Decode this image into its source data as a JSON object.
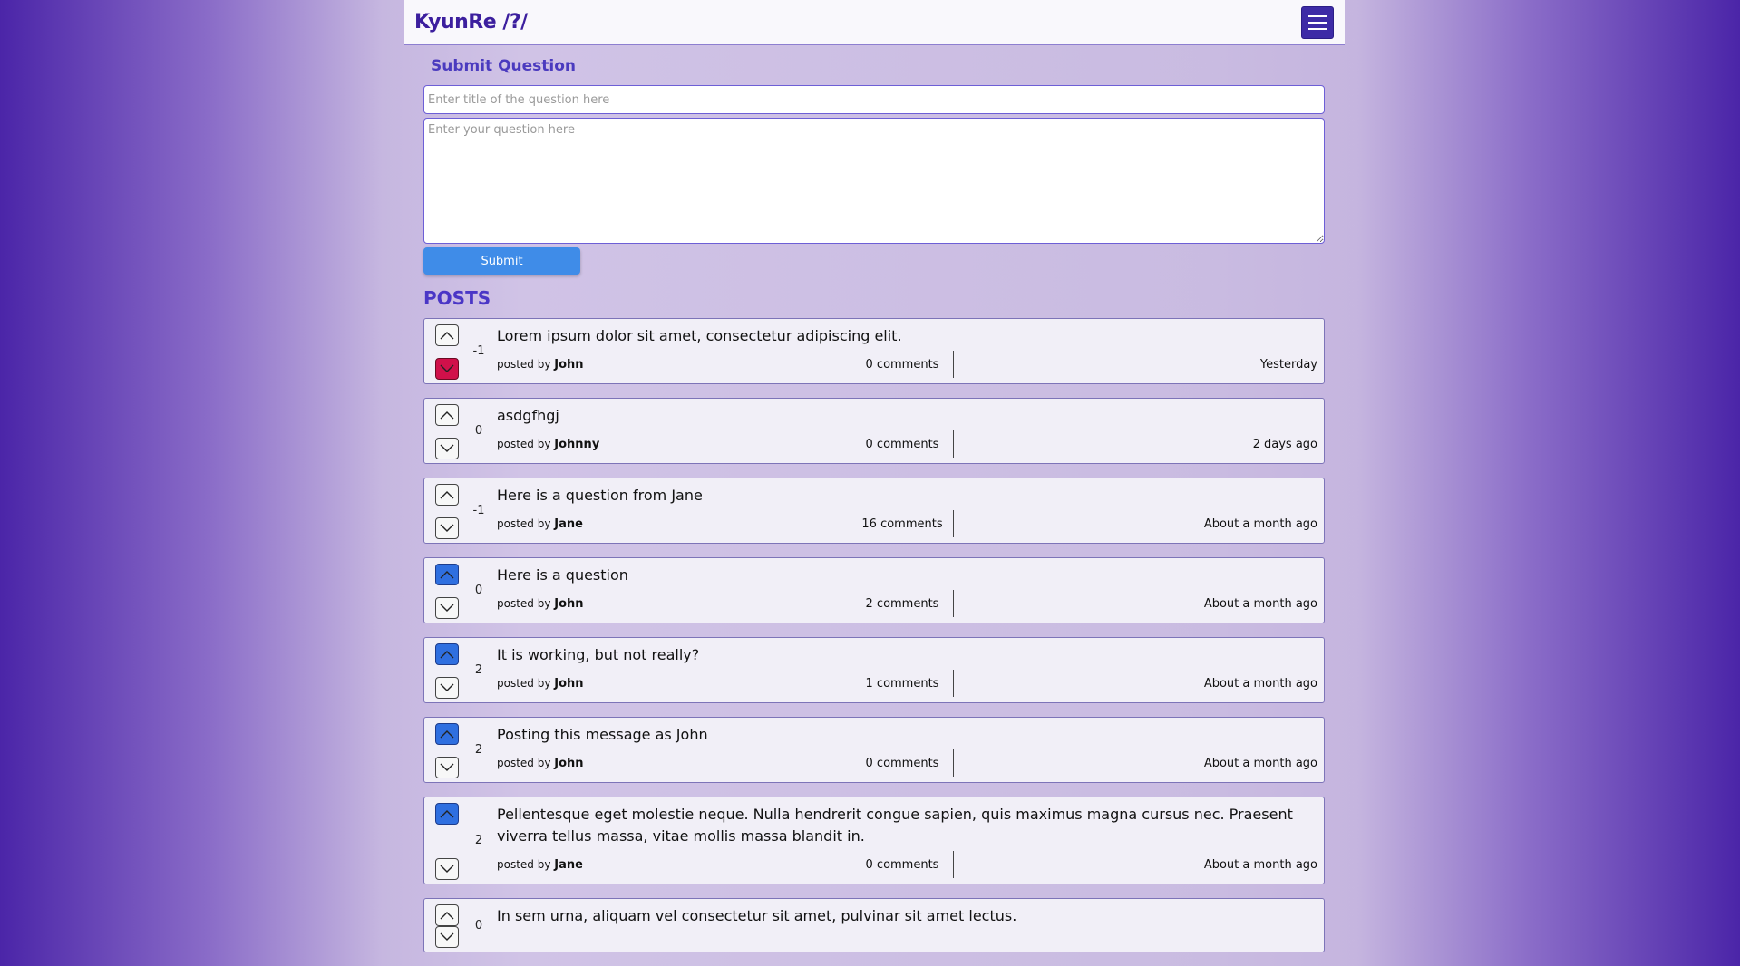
{
  "app": {
    "brand": "KyunRe /?/"
  },
  "submit": {
    "heading": "Submit Question",
    "title_placeholder": "Enter title of the question here",
    "body_placeholder": "Enter your question here",
    "button_label": "Submit"
  },
  "posts_heading": "POSTS",
  "posts": [
    {
      "title": "Lorem ipsum dolor sit amet, consectetur adipiscing elit.",
      "score": "-1",
      "posted_by": "posted by",
      "author": "John",
      "comments": "0 comments",
      "time": "Yesterday",
      "vote": "down"
    },
    {
      "title": "asdgfhgj",
      "score": "0",
      "posted_by": "posted by",
      "author": "Johnny",
      "comments": "0 comments",
      "time": "2 days ago",
      "vote": "none"
    },
    {
      "title": "Here is a question from Jane",
      "score": "-1",
      "posted_by": "posted by",
      "author": "Jane",
      "comments": "16 comments",
      "time": "About a month ago",
      "vote": "none"
    },
    {
      "title": "Here is a question",
      "score": "0",
      "posted_by": "posted by",
      "author": "John",
      "comments": "2 comments",
      "time": "About a month ago",
      "vote": "up"
    },
    {
      "title": "It is working, but not really?",
      "score": "2",
      "posted_by": "posted by",
      "author": "John",
      "comments": "1 comments",
      "time": "About a month ago",
      "vote": "up"
    },
    {
      "title": "Posting this message as John",
      "score": "2",
      "posted_by": "posted by",
      "author": "John",
      "comments": "0 comments",
      "time": "About a month ago",
      "vote": "up"
    },
    {
      "title": "Pellentesque eget molestie neque. Nulla hendrerit congue sapien, quis maximus magna cursus nec. Praesent viverra tellus massa, vitae mollis massa blandit in.",
      "score": "2",
      "posted_by": "posted by",
      "author": "Jane",
      "comments": "0 comments",
      "time": "About a month ago",
      "vote": "up"
    },
    {
      "title": "In sem urna, aliquam vel consectetur sit amet, pulvinar sit amet lectus.",
      "score": "0",
      "posted_by": "posted by",
      "author": "",
      "comments": "",
      "time": "",
      "vote": "none"
    }
  ]
}
